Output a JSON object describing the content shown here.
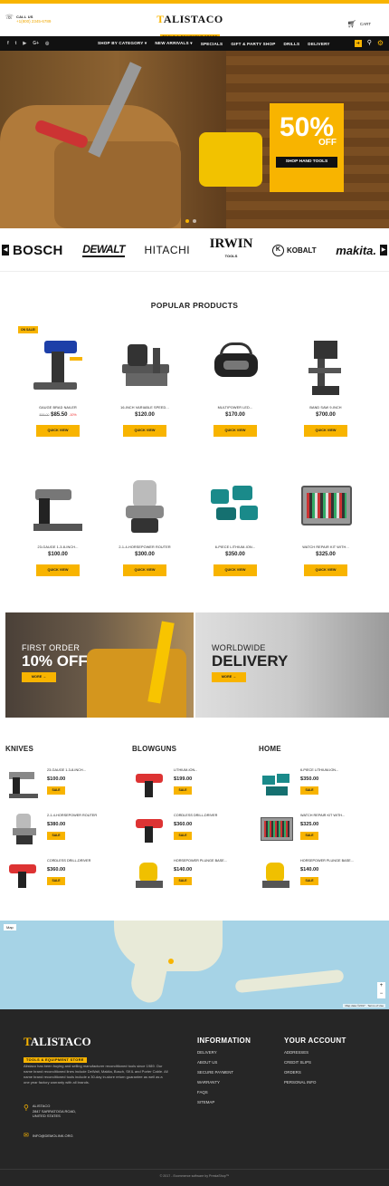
{
  "header": {
    "call_label": "CALL US",
    "phone": "+1(800) 2345-6789",
    "logo_name_1": "T",
    "logo_name_2": "ALISTACO",
    "logo_sub": "TOOLS & EQUIPMENT STORE",
    "cart_label": "CART"
  },
  "nav": {
    "social": [
      "f",
      "t",
      "▶",
      "G+",
      "◎"
    ],
    "items": [
      "SHOP BY CATEGORY ▾",
      "NEW ARRIVALS ▾",
      "SPECIALS",
      "GIFT & PARTY SHOP",
      "DRILLS",
      "DELIVERY"
    ]
  },
  "hero": {
    "percent": "50%",
    "off": "OFF",
    "button": "SHOP HAND TOOLS"
  },
  "brands": [
    "BOSCH",
    "DEWALT",
    "HITACHI",
    "IRWIN",
    "TOOLS",
    "KOBALT",
    "makita."
  ],
  "popular": {
    "title": "POPULAR PRODUCTS",
    "sale_badge": "ON SALE!",
    "products": [
      {
        "name": "GAUGE BRAD NAILER",
        "price": "$85.50",
        "old_price": "$95.00",
        "discount": "-10%",
        "button": "QUICK VIEW"
      },
      {
        "name": "16-INCH VARIABLE SPEED...",
        "price": "$120.00",
        "button": "QUICK VIEW"
      },
      {
        "name": "MULTIPOWER LED...",
        "price": "$170.00",
        "button": "QUICK VIEW"
      },
      {
        "name": "BAND SAW 9-INCH",
        "price": "$700.00",
        "button": "QUICK VIEW"
      },
      {
        "name": "23-GAUGE 1-3-8-INCH...",
        "price": "$100.00",
        "button": "QUICK VIEW"
      },
      {
        "name": "2-1-4-HORSEPOWER ROUTER",
        "price": "$300.00",
        "button": "QUICK VIEW"
      },
      {
        "name": "6-PIECE LITHIUM-ION...",
        "price": "$350.00",
        "button": "QUICK VIEW"
      },
      {
        "name": "WATCH REPAIR KIT WITH...",
        "price": "$325.00",
        "button": "QUICK VIEW"
      }
    ]
  },
  "banners": [
    {
      "line1": "FIRST ORDER",
      "line2": "10% OFF",
      "button": "MORE →"
    },
    {
      "line1": "WORLDWIDE",
      "line2": "DELIVERY",
      "button": "MORE →"
    }
  ],
  "columns": [
    {
      "title": "KNIVES",
      "items": [
        {
          "name": "23-GAUGE 1-3-8-INCH...",
          "price": "$100.00",
          "button": "SALE"
        },
        {
          "name": "2-1-4-HORSEPOWER ROUTER",
          "price": "$380.00",
          "button": "SALE"
        },
        {
          "name": "CORDLESS DRILL-DRIVER",
          "price": "$360.00",
          "button": "SALE"
        }
      ]
    },
    {
      "title": "BLOWGUNS",
      "items": [
        {
          "name": "LITHIUM-ION...",
          "price": "$199.00",
          "button": "SALE"
        },
        {
          "name": "CORDLESS DRILL-DRIVER",
          "price": "$360.00",
          "button": "SALE"
        },
        {
          "name": "HORSEPOWER PLUNGE BASE...",
          "price": "$140.00",
          "button": "SALE"
        }
      ]
    },
    {
      "title": "HOME",
      "items": [
        {
          "name": "6-PIECE LITHIUM-ION...",
          "price": "$350.00",
          "button": "SALE"
        },
        {
          "name": "WATCH REPAIR KIT WITH...",
          "price": "$325.00",
          "button": "SALE"
        },
        {
          "name": "HORSEPOWER PLUNGE BASE...",
          "price": "$140.00",
          "button": "SALE"
        }
      ]
    }
  ],
  "map": {
    "type_label": "Map",
    "attribution": "Map data ©2017 · Terms of Use"
  },
  "footer": {
    "logo_name_1": "T",
    "logo_name_2": "ALISTACO",
    "logo_sub": "TOOLS & EQUIPMENT STORE",
    "about": "Alistaco has been buying and selling manufacturer reconditioned tools since 1989. Our name brand reconditioned lines include DeWalt, Makita, Bosch, SKIL and Porter Cable. All name brand reconditioned tools include a 30-day in-store return guarantee as well as a one year factory warranty with all brands.",
    "address_lines": [
      "ALISTACO",
      "2847 SARRATOGA ROAD,",
      "UNITED STATES"
    ],
    "email": "INFO@DEMOLINK.ORG",
    "information_title": "INFORMATION",
    "information_links": [
      "DELIVERY",
      "ABOUT US",
      "SECURE PAYMENT",
      "WARRANTY",
      "FAQS",
      "SITEMAP"
    ],
    "account_title": "YOUR ACCOUNT",
    "account_links": [
      "ADDRESSES",
      "CREDIT SLIPS",
      "ORDERS",
      "PERSONAL INFO"
    ],
    "copyright": "© 2017 - Ecommerce software by PrestaShop™"
  },
  "colors": {
    "accent": "#f8b400",
    "dark": "#111111",
    "footer": "#262626"
  }
}
